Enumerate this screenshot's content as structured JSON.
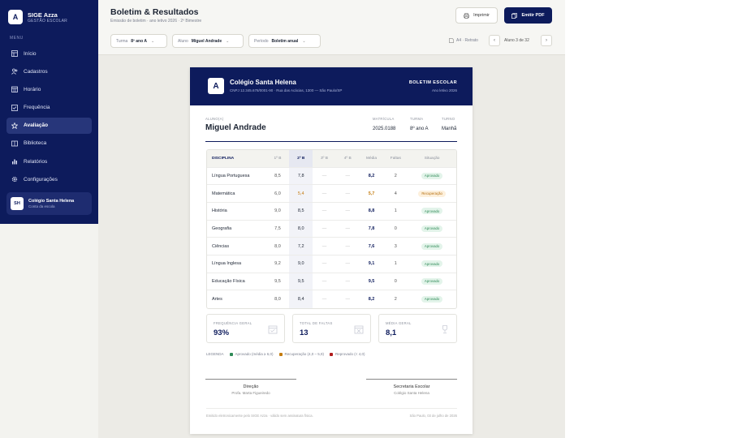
{
  "app": {
    "logo_letter": "A",
    "name": "SIGE Azza",
    "subtitle": "GESTÃO ESCOLAR"
  },
  "sidebar": {
    "menu_header": "MENU",
    "items": [
      {
        "label": "Início",
        "icon": "grid-icon"
      },
      {
        "label": "Cadastros",
        "icon": "users-icon"
      },
      {
        "label": "Horário",
        "icon": "calendar-icon"
      },
      {
        "label": "Frequência",
        "icon": "checklist-icon"
      },
      {
        "label": "Avaliação",
        "icon": "star-icon",
        "active": true
      },
      {
        "label": "Biblioteca",
        "icon": "book-icon"
      },
      {
        "label": "Relatórios",
        "icon": "chart-icon"
      },
      {
        "label": "Configurações",
        "icon": "gear-icon"
      }
    ],
    "school": {
      "initials": "SH",
      "name": "Colégio Santa Helena",
      "sub": "Conta da escola"
    }
  },
  "header": {
    "title": "Boletim & Resultados",
    "subtitle": "Emissão de boletim · ano letivo 2026 · 2º Bimestre",
    "print_label": "Imprimir",
    "pdf_label": "Emitir PDF"
  },
  "filters": {
    "turma": {
      "label": "Turma",
      "value": "8º ano A"
    },
    "aluno": {
      "label": "Aluno",
      "value": "Miguel Andrade"
    },
    "periodo": {
      "label": "Período",
      "value": "Boletim anual"
    }
  },
  "pager": {
    "format": "A4 · Retrato",
    "position": "Aluno 3 de 32",
    "prev": "‹",
    "next": "›"
  },
  "report": {
    "logo_letter": "A",
    "school": "Colégio Santa Helena",
    "address": "CNPJ 12.345.678/0001-90 · Rua das Acácias, 1300 — São Paulo/SP",
    "doc_type": "BOLETIM ESCOLAR",
    "year": "Ano letivo 2026",
    "student": {
      "label": "ALUNO(A)",
      "name": "Miguel Andrade",
      "matricula_label": "MATRÍCULA",
      "matricula": "2025.0188",
      "turma_label": "TURMA",
      "turma": "8º ano A",
      "turno_label": "TURNO",
      "turno": "Manhã"
    },
    "columns": [
      "DISCIPLINA",
      "1º B",
      "2º B",
      "3º B",
      "4º B",
      "Média",
      "Faltas",
      "Situação"
    ],
    "rows": [
      {
        "disciplina": "Língua Portuguesa",
        "b1": "8,5",
        "b2": "7,8",
        "b3": "—",
        "b4": "—",
        "media": "8,2",
        "faltas": "2",
        "situacao": "Aprovado"
      },
      {
        "disciplina": "Matemática",
        "b1": "6,0",
        "b2": "5,4",
        "b3": "—",
        "b4": "—",
        "media": "5,7",
        "faltas": "4",
        "situacao": "Recuperação"
      },
      {
        "disciplina": "História",
        "b1": "9,0",
        "b2": "8,5",
        "b3": "—",
        "b4": "—",
        "media": "8,8",
        "faltas": "1",
        "situacao": "Aprovado"
      },
      {
        "disciplina": "Geografia",
        "b1": "7,5",
        "b2": "8,0",
        "b3": "—",
        "b4": "—",
        "media": "7,8",
        "faltas": "0",
        "situacao": "Aprovado"
      },
      {
        "disciplina": "Ciências",
        "b1": "8,0",
        "b2": "7,2",
        "b3": "—",
        "b4": "—",
        "media": "7,6",
        "faltas": "3",
        "situacao": "Aprovado"
      },
      {
        "disciplina": "Língua Inglesa",
        "b1": "9,2",
        "b2": "9,0",
        "b3": "—",
        "b4": "—",
        "media": "9,1",
        "faltas": "1",
        "situacao": "Aprovado"
      },
      {
        "disciplina": "Educação Física",
        "b1": "9,5",
        "b2": "9,5",
        "b3": "—",
        "b4": "—",
        "media": "9,5",
        "faltas": "0",
        "situacao": "Aprovado"
      },
      {
        "disciplina": "Artes",
        "b1": "8,0",
        "b2": "8,4",
        "b3": "—",
        "b4": "—",
        "media": "8,2",
        "faltas": "2",
        "situacao": "Aprovado"
      }
    ],
    "stats": {
      "freq_label": "FREQUÊNCIA GERAL",
      "freq": "93%",
      "faltas_label": "TOTAL DE FALTAS",
      "faltas": "13",
      "media_label": "MÉDIA GERAL",
      "media": "8,1"
    },
    "legend": {
      "title": "LEGENDA",
      "approved": "Aprovado (média ≥ 6,0)",
      "recovery": "Recuperação (4,0 – 5,9)",
      "failed": "Reprovado (< 4,0)"
    },
    "signatures": {
      "left_role": "Direção",
      "left_name": "Profa. Marta Figueiredo",
      "right_role": "Secretaria Escolar",
      "right_name": "Colégio Santa Helena"
    },
    "footer_left": "Emitido eletronicamente pelo SIGE Azza · válido sem assinatura física.",
    "footer_right": "São Paulo, 03 de julho de 2026"
  },
  "colors": {
    "brand": "#0d1b5c",
    "approved": "#2f8a57",
    "recovery": "#c47c10",
    "failed": "#b01c1c"
  }
}
